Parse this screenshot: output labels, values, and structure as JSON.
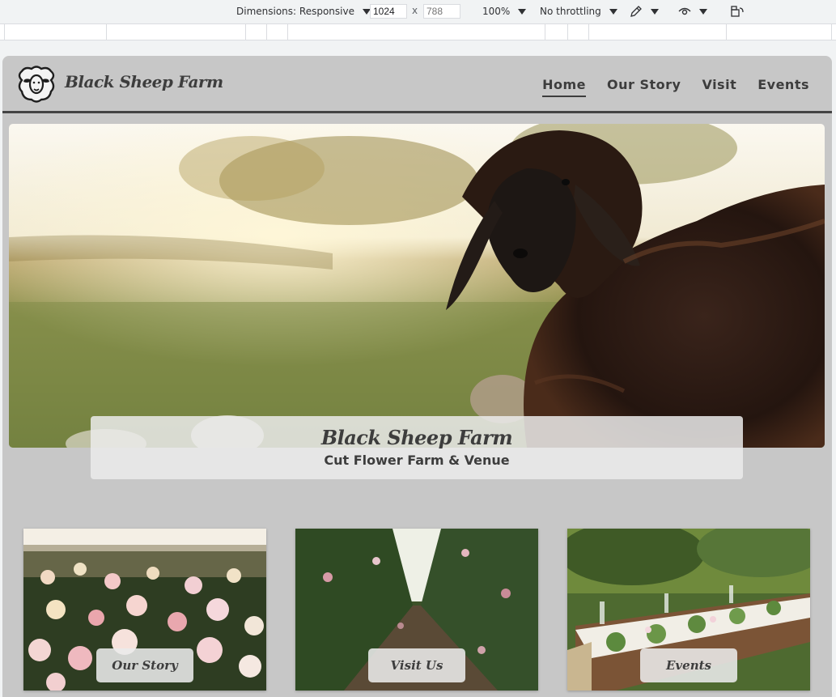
{
  "devtools": {
    "dimensions_label": "Dimensions: Responsive",
    "width_value": "1024",
    "height_placeholder": "788",
    "times": "x",
    "zoom": "100%",
    "throttling": "No throttling"
  },
  "site": {
    "brand": "Black Sheep Farm",
    "nav": [
      {
        "label": "Home",
        "active": true
      },
      {
        "label": "Our Story",
        "active": false
      },
      {
        "label": "Visit",
        "active": false
      },
      {
        "label": "Events",
        "active": false
      }
    ],
    "hero": {
      "title": "Black Sheep Farm",
      "subtitle": "Cut Flower Farm & Venue"
    },
    "cards": [
      {
        "label": "Our Story"
      },
      {
        "label": "Visit Us"
      },
      {
        "label": "Events"
      }
    ]
  },
  "colors": {
    "page_bg": "#c7c7c7",
    "text": "#3d3d3d",
    "devtools_bg": "#f1f3f4"
  }
}
